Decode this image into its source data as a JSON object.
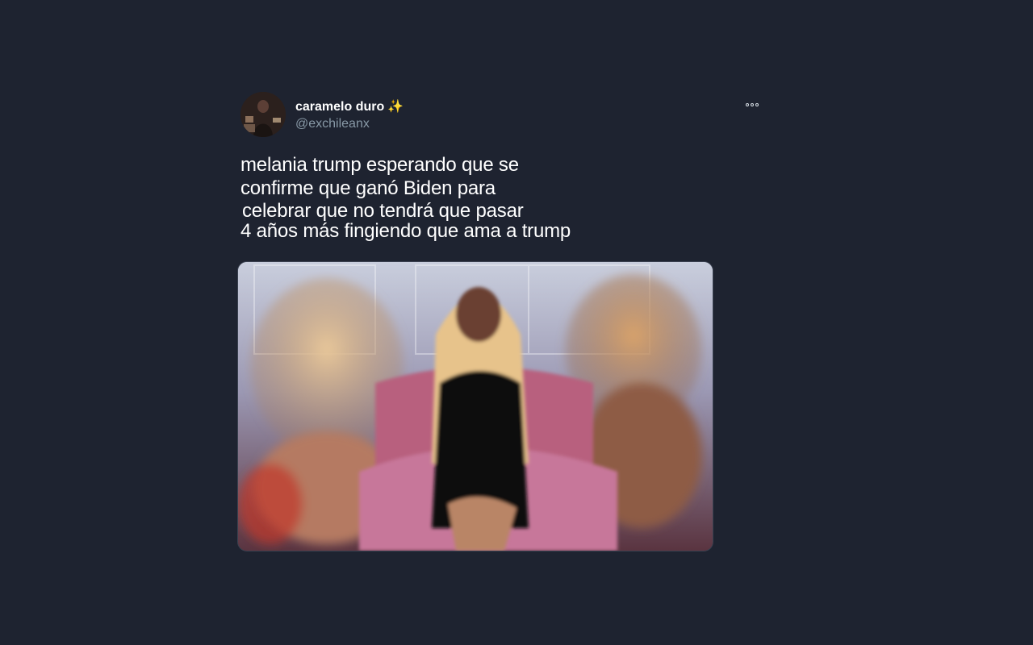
{
  "tweet": {
    "display_name": "caramelo duro",
    "name_emoji": "✨",
    "handle": "@exchileanx",
    "text_lines": [
      "melania trump esperando que se",
      "confirme que ganó Biden para",
      "celebrar que no tendrá que pasar",
      "4 años más fingiendo que ama a trump"
    ]
  },
  "colors": {
    "background": "#1e2330",
    "text_primary": "#ffffff",
    "text_secondary": "#8899a6",
    "emoji": "#f5c518"
  },
  "icons": {
    "more": "more-options-icon",
    "avatar": "avatar-image"
  }
}
